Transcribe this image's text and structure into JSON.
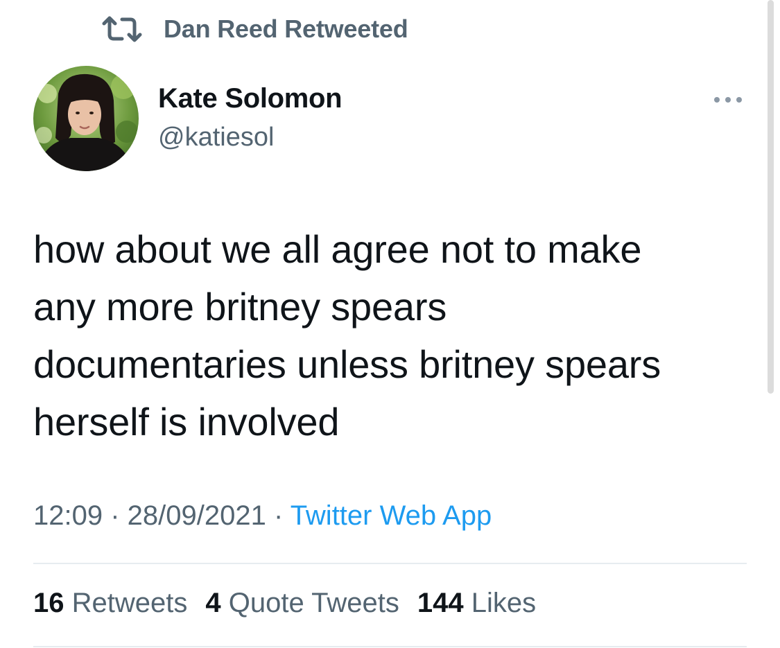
{
  "retweet_context": {
    "icon": "retweet-icon",
    "label": "Dan Reed Retweeted"
  },
  "author": {
    "name": "Kate Solomon",
    "handle": "@katiesol",
    "avatar": "profile-photo"
  },
  "more_icon": "more-dots-icon",
  "tweet": {
    "text": "how about we all agree not to make\nany more britney spears\ndocumentaries unless britney spears\nherself is involved",
    "time": "12:09",
    "separator": " · ",
    "date": "28/09/2021",
    "source": "Twitter Web App"
  },
  "stats": {
    "retweets_count": "16",
    "retweets_label": "Retweets",
    "quotes_count": "4",
    "quotes_label": "Quote Tweets",
    "likes_count": "144",
    "likes_label": "Likes"
  },
  "colors": {
    "text_primary": "#0f1419",
    "text_secondary": "#536471",
    "link": "#1d9bf0",
    "divider": "#e6ecf0"
  }
}
